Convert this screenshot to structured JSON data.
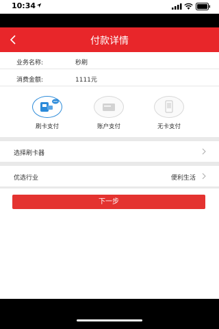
{
  "status_bar": {
    "time": "10:34"
  },
  "nav": {
    "title": "付款详情"
  },
  "info": [
    {
      "label": "业务名称:",
      "value": "秒刷"
    },
    {
      "label": "消费金额:",
      "value": "1111元"
    }
  ],
  "pay_options": [
    {
      "label": "刷卡支付",
      "selected": true
    },
    {
      "label": "账户支付",
      "selected": false
    },
    {
      "label": "无卡支付",
      "selected": false
    }
  ],
  "rows": {
    "card_reader": {
      "label": "选择刷卡器"
    },
    "industry": {
      "label": "优选行业",
      "value": "便利生活"
    }
  },
  "next_button": {
    "label": "下一步"
  },
  "colors": {
    "brand_red": "#e8262a",
    "selected_blue": "#2b8ad9"
  }
}
